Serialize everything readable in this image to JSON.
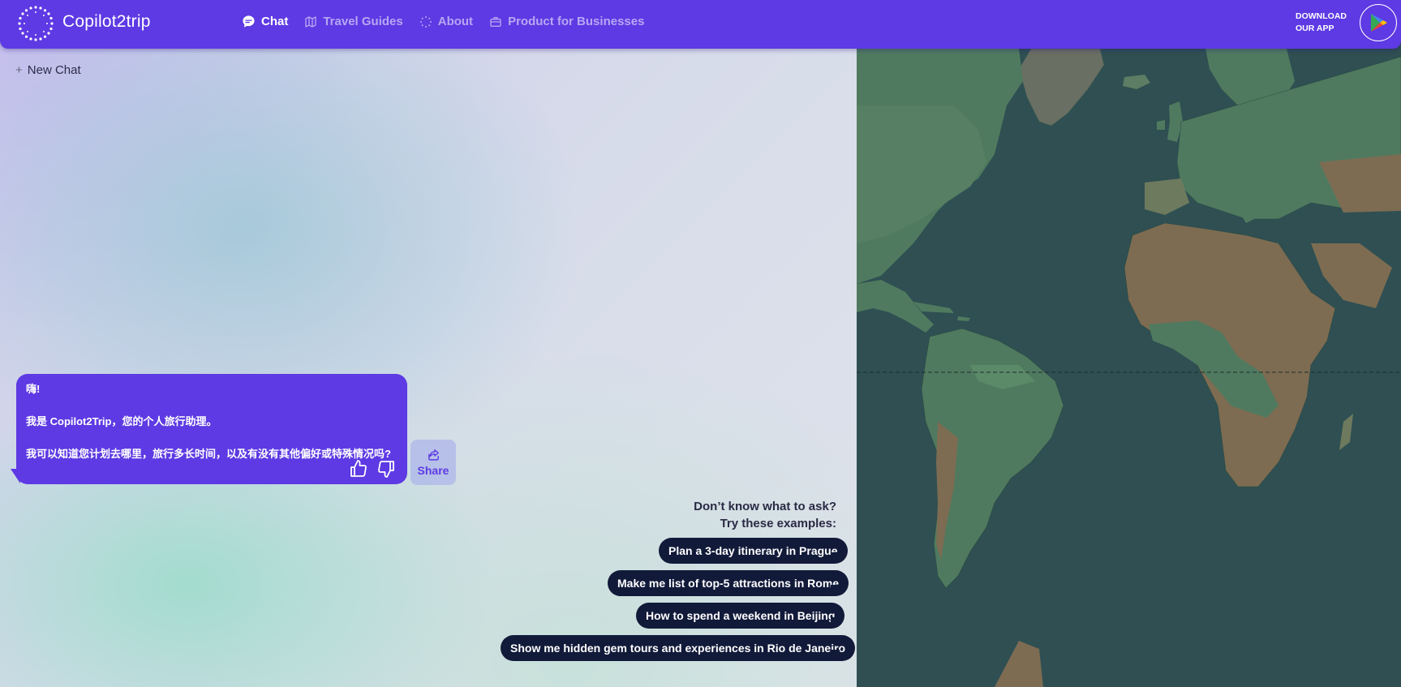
{
  "header": {
    "brand": "Copilot2trip",
    "nav": [
      {
        "label": "Chat",
        "icon": "chat-bubble-icon",
        "active": true
      },
      {
        "label": "Travel Guides",
        "icon": "map-icon",
        "active": false
      },
      {
        "label": "About",
        "icon": "sparkle-icon",
        "active": false
      },
      {
        "label": "Product for Businesses",
        "icon": "briefcase-icon",
        "active": false
      }
    ],
    "download_line1": "DOWNLOAD",
    "download_line2": "OUR APP",
    "store_icon": "google-play-icon"
  },
  "chat": {
    "new_chat_label": "New Chat",
    "assistant_message": {
      "line1": "嗨!",
      "line2": "我是 Copilot2Trip，您的个人旅行助理。",
      "line3": "我可以知道您计划去哪里，旅行多长时间，以及有没有其他偏好或特殊情况吗?"
    },
    "share_label": "Share",
    "examples_title_line1": "Don’t know what to ask?",
    "examples_title_line2": "Try these examples:",
    "examples": [
      "Plan a 3-day itinerary in Prague",
      "Make me list of top-5 attractions in Rome",
      "How to spend a weekend in Beijing",
      "Show me hidden gem tours and experiences in Rio de Janeiro"
    ]
  },
  "colors": {
    "brand_purple": "#5d3ae3",
    "chip_navy": "#121a3a",
    "ocean": "#2f4f52",
    "land_green": "#4f7a5f",
    "land_desert": "#7d6c52"
  }
}
